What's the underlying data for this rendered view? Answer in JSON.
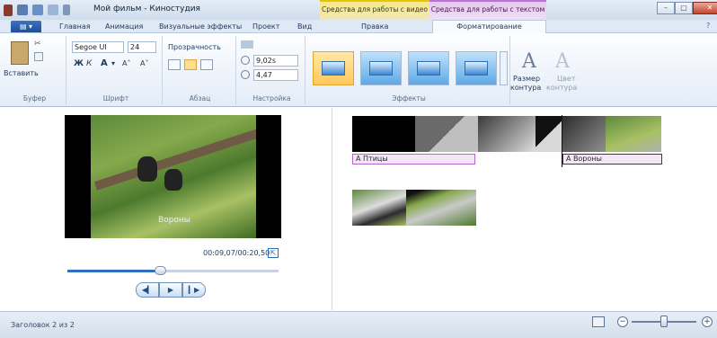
{
  "window": {
    "title": "Мой фильм - Киностудия",
    "context_video": "Средства для работы с видео",
    "context_text": "Средства для работы с текстом",
    "min": "–",
    "max": "▢",
    "close": "✕"
  },
  "tabs": {
    "file": "▤ ▾",
    "items": [
      "Главная",
      "Анимация",
      "Визуальные эффекты",
      "Проект",
      "Вид"
    ],
    "edit": "Правка",
    "format": "Форматирование",
    "help": "?"
  },
  "ribbon": {
    "clipboard": {
      "paste": "Вставить",
      "label": "Буфер"
    },
    "font": {
      "family": "Segoe UI",
      "size": "24",
      "bold": "Ж",
      "italic": "К",
      "grow": "A",
      "grow_arrow": "▾",
      "big": "A˄",
      "small": "A˅",
      "label": "Шрифт"
    },
    "paragraph": {
      "transparency": "Прозрачность",
      "label": "Абзац"
    },
    "setup": {
      "start_time": "9,02s",
      "duration": "4,47",
      "label": "Настройка"
    },
    "effects": {
      "label": "Эффекты"
    },
    "outline": {
      "size": "Размер",
      "size2": "контура",
      "color": "Цвет",
      "color2": "контура"
    }
  },
  "preview": {
    "overlay_text": "Вороны",
    "timecode": "00:09,07/00:20,50",
    "fullscreen": "⇱",
    "progress": 0.44,
    "prev": "◀▎",
    "play": "▶",
    "next": "▎▶"
  },
  "timeline": {
    "caption1": "A Птицы",
    "caption2": "A Вороны"
  },
  "status": {
    "text": "Заголовок 2 из 2",
    "zoom_minus": "−",
    "zoom_plus": "+"
  },
  "colors": {
    "ribbon_accent": "#1c4e9c",
    "context_video": "#f1e7b5",
    "context_text": "#e7c8f0",
    "caption_border": "#b26ac6"
  }
}
